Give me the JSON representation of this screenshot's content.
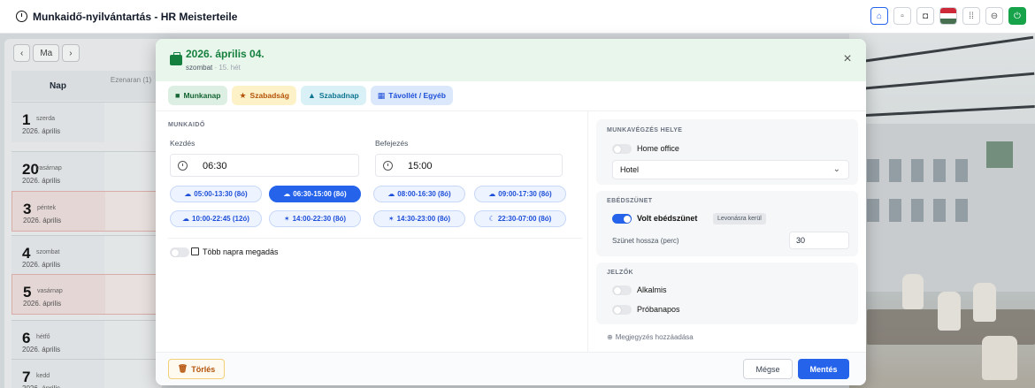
{
  "app": {
    "title": "Munkaidő-nyilvántartás - HR Meisterteile"
  },
  "calendar": {
    "today_label": "Ma",
    "col_day": "Nap",
    "col_second": "Ezenaran (1)",
    "rows": [
      {
        "num": "1",
        "dname": "szerda",
        "date": "2026. április",
        "red": false
      },
      {
        "num": "20",
        "dname": "vasárnap",
        "date": "2026. április",
        "red": false
      },
      {
        "num": "3",
        "dname": "péntek",
        "date": "2026. április",
        "red": true
      },
      {
        "num": "4",
        "dname": "szombat",
        "date": "2026. április",
        "red": false
      },
      {
        "num": "5",
        "dname": "vasárnap",
        "date": "2026. április",
        "red": true
      },
      {
        "num": "6",
        "dname": "hétfő",
        "date": "2026. április",
        "red": false
      },
      {
        "num": "7",
        "dname": "kedd",
        "date": "2026. április",
        "red": false
      }
    ]
  },
  "modal": {
    "date": "2026. április 04.",
    "weekday": "szombat",
    "week": "· 15. hét",
    "tabs": [
      {
        "label": "Munkanap",
        "icon": "suitcase-icon",
        "glyph": "■",
        "style": "green"
      },
      {
        "label": "Szabadság",
        "icon": "star-icon",
        "glyph": "★",
        "style": "yellow"
      },
      {
        "label": "Szabadnap",
        "icon": "triangle-icon",
        "glyph": "▲",
        "style": "cyan"
      },
      {
        "label": "Távollét / Egyéb",
        "icon": "calendar-icon",
        "glyph": "▦",
        "style": "blue"
      }
    ],
    "worktime": {
      "section": "MUNKAIDŐ",
      "start_label": "Kezdés",
      "start_value": "06:30",
      "end_label": "Befejezés",
      "end_value": "15:00"
    },
    "shifts": [
      {
        "label": "05:00-13:30 (8ó)",
        "icon": "☁",
        "active": false
      },
      {
        "label": "06:30-15:00 (8ó)",
        "icon": "☁",
        "active": true
      },
      {
        "label": "08:00-16:30 (8ó)",
        "icon": "☁",
        "active": false
      },
      {
        "label": "09:00-17:30 (8ó)",
        "icon": "☁",
        "active": false
      },
      {
        "label": "10:00-22:45 (12ó)",
        "icon": "☁",
        "active": false
      },
      {
        "label": "14:00-22:30 (8ó)",
        "icon": "✶",
        "active": false
      },
      {
        "label": "14:30-23:00 (8ó)",
        "icon": "✶",
        "active": false
      },
      {
        "label": "22:30-07:00 (8ó)",
        "icon": "☾",
        "active": false
      }
    ],
    "multi_day_label": "Több napra megadás",
    "workplace": {
      "section": "MUNKAVÉGZÉS HELYE",
      "home_office_label": "Home office",
      "location_value": "Hotel"
    },
    "lunch": {
      "section": "EBÉDSZÜNET",
      "had_lunch_label": "Volt ebédszünet",
      "deduct_tag": "Levonásra kerül",
      "duration_label": "Szünet hossza (perc)",
      "duration_value": "30"
    },
    "flags": {
      "section": "JELZŐK",
      "casual_label": "Alkalmis",
      "trial_label": "Próbanapos"
    },
    "note_link": "Megjegyzés hozzáadása",
    "buttons": {
      "delete": "Törlés",
      "cancel": "Mégse",
      "save": "Mentés"
    }
  },
  "colors": {
    "accent": "#2563eb",
    "header_green": "#15803d",
    "save_blue": "#2563eb"
  }
}
